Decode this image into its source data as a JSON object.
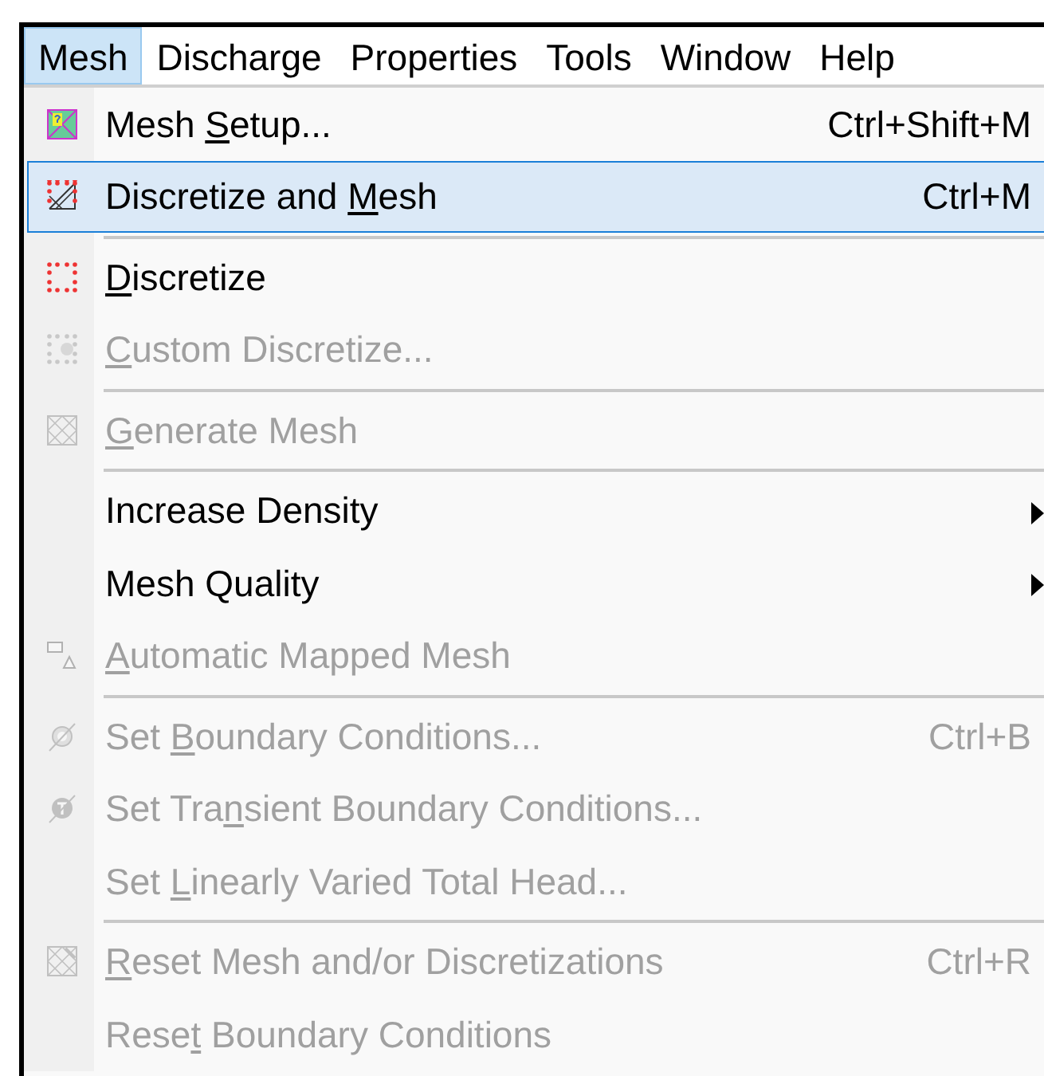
{
  "menubar": [
    {
      "label": "Mesh",
      "selected": true
    },
    {
      "label": "Discharge",
      "selected": false
    },
    {
      "label": "Properties",
      "selected": false
    },
    {
      "label": "Tools",
      "selected": false
    },
    {
      "label": "Window",
      "selected": false
    },
    {
      "label": "Help",
      "selected": false
    }
  ],
  "menu": {
    "items": [
      {
        "kind": "item",
        "pre": "Mesh ",
        "key": "S",
        "post": "etup...",
        "shortcut": "Ctrl+Shift+M",
        "disabled": false,
        "selected": false
      },
      {
        "kind": "item",
        "pre": "Discretize and ",
        "key": "M",
        "post": "esh",
        "shortcut": "Ctrl+M",
        "disabled": false,
        "selected": true
      },
      {
        "kind": "separator"
      },
      {
        "kind": "item",
        "key": "D",
        "post": "iscretize",
        "disabled": false,
        "selected": false
      },
      {
        "kind": "item",
        "key": "C",
        "post": "ustom Discretize...",
        "disabled": true,
        "selected": false
      },
      {
        "kind": "separator"
      },
      {
        "kind": "item",
        "key": "G",
        "post": "enerate Mesh",
        "disabled": true,
        "selected": false
      },
      {
        "kind": "separator"
      },
      {
        "kind": "item",
        "pre": "Increase Density",
        "submenu": true,
        "disabled": false,
        "selected": false
      },
      {
        "kind": "item",
        "pre": "Mesh Quality",
        "submenu": true,
        "disabled": false,
        "selected": false
      },
      {
        "kind": "item",
        "key": "A",
        "post": "utomatic Mapped Mesh",
        "disabled": true,
        "selected": false
      },
      {
        "kind": "separator"
      },
      {
        "kind": "item",
        "pre": "Set ",
        "key": "B",
        "post": "oundary Conditions...",
        "shortcut": "Ctrl+B",
        "disabled": true,
        "selected": false
      },
      {
        "kind": "item",
        "pre": "Set Tra",
        "key": "n",
        "post": "sient Boundary Conditions...",
        "disabled": true,
        "selected": false
      },
      {
        "kind": "item",
        "pre": "Set ",
        "key": "L",
        "post": "inearly Varied Total Head...",
        "disabled": true,
        "selected": false
      },
      {
        "kind": "separator"
      },
      {
        "kind": "item",
        "key": "R",
        "post": "eset Mesh and/or Discretizations",
        "shortcut": "Ctrl+R",
        "disabled": true,
        "selected": false
      },
      {
        "kind": "item",
        "pre": "Rese",
        "key": "t",
        "post": " Boundary Conditions",
        "disabled": true,
        "selected": false
      }
    ]
  }
}
